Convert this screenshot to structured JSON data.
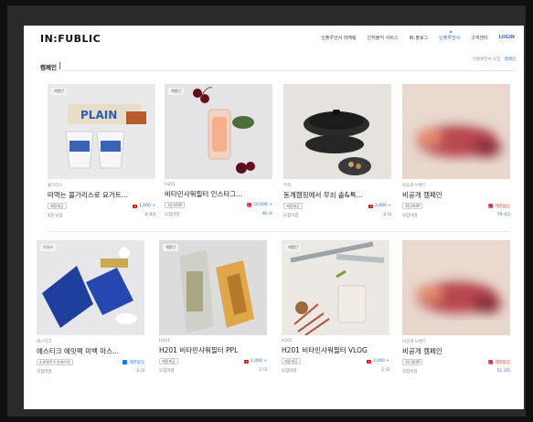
{
  "header": {
    "logo": "IN:FUBLIC",
    "nav": [
      "인플루언서 마케팅",
      "인허블익 서비스",
      "IN:블로그",
      "인플루언서",
      "고객센터",
      "LOGIN"
    ],
    "active_index": 3
  },
  "subbar": {
    "title": "캠페인",
    "breadcrumb_parent": "인플루언서 모집",
    "breadcrumb_current": "캠페인"
  },
  "cards": [
    {
      "badge": "체험단",
      "brand": "불가리스",
      "title": "떠먹는 불가리스로 요거트...",
      "pill": "제품제공",
      "channel": "youtube",
      "reward": "1,000 +",
      "status": "1일 남음",
      "count": "0 /10"
    },
    {
      "badge": "체험단",
      "brand": "H201",
      "title": "비타민샤워필터 인스타그...",
      "pill": "30,000P",
      "channel": "instagram",
      "reward": "50,000 +",
      "status": "모집마감",
      "count": "46 /4"
    },
    {
      "badge": "",
      "brand": "무쇠",
      "title": "동계캠핑에서 무쇠 솥&특...",
      "pill": "제품제공",
      "channel": "youtube",
      "reward": "3,000 +",
      "status": "모집마감",
      "count": "2 /3"
    },
    {
      "badge": "",
      "brand": "비공개 브랜드",
      "title": "비공개 캠페인",
      "pill": "30,000P",
      "channel": "instagram",
      "reward": "제한없음",
      "status": "모집마감",
      "count": "79 /15"
    },
    {
      "badge": "기자스",
      "brand": "에스티크",
      "title": "에스티크 에밋팩 미백 마스...",
      "pill": "4,000P X 판매수량",
      "channel": "facebook",
      "reward": "제한없음",
      "status": "모집마감",
      "count": "2 /3"
    },
    {
      "badge": "체험단",
      "brand": "H201",
      "title": "H201 비타민샤워필터 PPL",
      "pill": "제품제공",
      "channel": "youtube",
      "reward": "1,000 +",
      "status": "모집마감",
      "count": "1 /3"
    },
    {
      "badge": "체험단",
      "brand": "H201",
      "title": "H201 비타민샤워필터 VLOG",
      "pill": "제품제공",
      "channel": "youtube",
      "reward": "3,000 +",
      "status": "모집마감",
      "count": "1 /3"
    },
    {
      "badge": "",
      "brand": "비공개 브랜드",
      "title": "비공개 캠페인",
      "pill": "30,000P",
      "channel": "instagram",
      "reward": "제한없음",
      "status": "모집마감",
      "count": "51 /25"
    }
  ]
}
